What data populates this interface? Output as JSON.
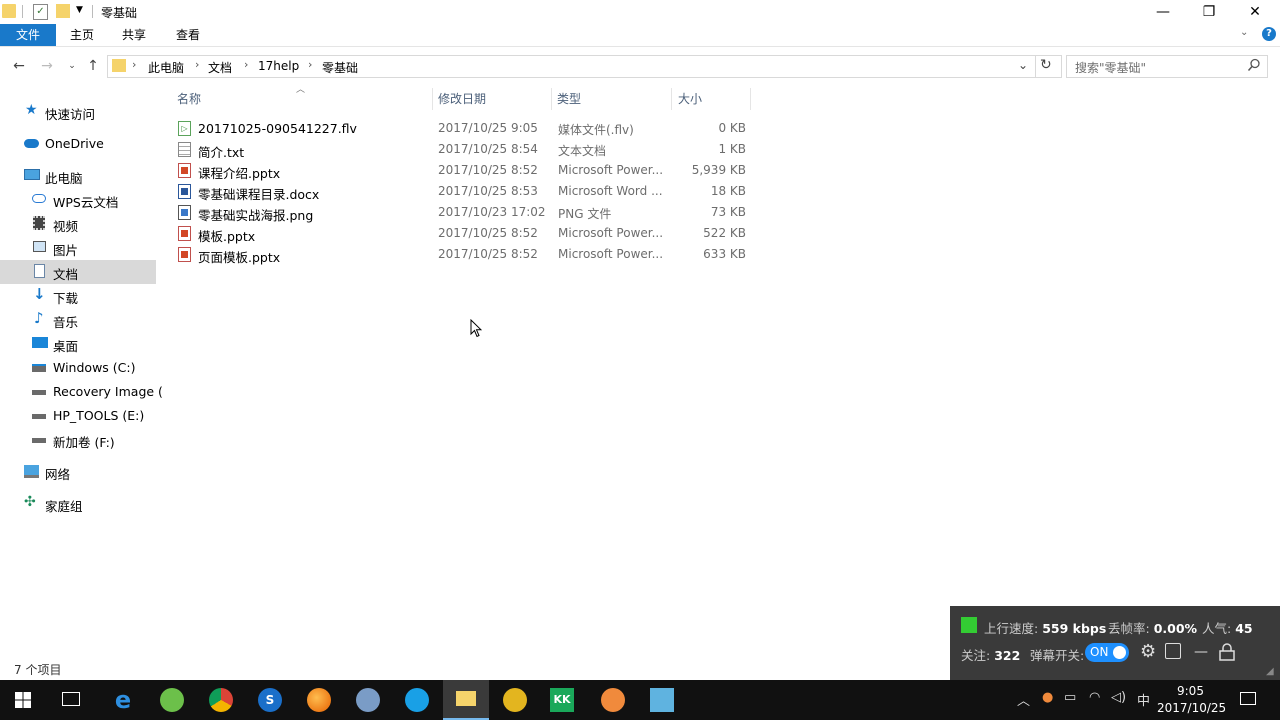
{
  "window": {
    "title": "零基础",
    "controls": {
      "minimize": "—",
      "maximize": "❐",
      "close": "✕"
    }
  },
  "ribbon": {
    "tabs": [
      "文件",
      "主页",
      "共享",
      "查看"
    ],
    "help": "?"
  },
  "address": {
    "crumbs": [
      "此电脑",
      "文档",
      "17help",
      "零基础"
    ],
    "search_placeholder": "搜索\"零基础\""
  },
  "sidebar": {
    "items": [
      {
        "label": "快速访问",
        "icon": "star-icon"
      },
      {
        "label": "OneDrive",
        "icon": "cloud-icon"
      },
      {
        "label": "此电脑",
        "icon": "computer-icon"
      },
      {
        "label": "WPS云文档",
        "icon": "cloud-outline-icon"
      },
      {
        "label": "视频",
        "icon": "video-icon"
      },
      {
        "label": "图片",
        "icon": "picture-icon"
      },
      {
        "label": "文档",
        "icon": "document-icon",
        "selected": true
      },
      {
        "label": "下载",
        "icon": "download-icon"
      },
      {
        "label": "音乐",
        "icon": "music-icon"
      },
      {
        "label": "桌面",
        "icon": "desktop-icon"
      },
      {
        "label": "Windows (C:)",
        "icon": "drive-c-icon"
      },
      {
        "label": "Recovery Image (",
        "icon": "drive-icon"
      },
      {
        "label": "HP_TOOLS (E:)",
        "icon": "drive-icon"
      },
      {
        "label": "新加卷 (F:)",
        "icon": "drive-icon"
      },
      {
        "label": "网络",
        "icon": "network-icon"
      },
      {
        "label": "家庭组",
        "icon": "homegroup-icon"
      }
    ]
  },
  "columns": {
    "name": "名称",
    "date": "修改日期",
    "type": "类型",
    "size": "大小"
  },
  "files": [
    {
      "name": "20171025-090541227.flv",
      "date": "2017/10/25 9:05",
      "type": "媒体文件(.flv)",
      "size": "0 KB",
      "icon": "video-file-icon"
    },
    {
      "name": "简介.txt",
      "date": "2017/10/25 8:54",
      "type": "文本文档",
      "size": "1 KB",
      "icon": "text-file-icon"
    },
    {
      "name": "课程介绍.pptx",
      "date": "2017/10/25 8:52",
      "type": "Microsoft Power...",
      "size": "5,939 KB",
      "icon": "pptx-file-icon"
    },
    {
      "name": "零基础课程目录.docx",
      "date": "2017/10/25 8:53",
      "type": "Microsoft Word ...",
      "size": "18 KB",
      "icon": "docx-file-icon"
    },
    {
      "name": "零基础实战海报.png",
      "date": "2017/10/23 17:02",
      "type": "PNG 文件",
      "size": "73 KB",
      "icon": "image-file-icon"
    },
    {
      "name": "模板.pptx",
      "date": "2017/10/25 8:52",
      "type": "Microsoft Power...",
      "size": "522 KB",
      "icon": "pptx-file-icon"
    },
    {
      "name": "页面模板.pptx",
      "date": "2017/10/25 8:52",
      "type": "Microsoft Power...",
      "size": "633 KB",
      "icon": "pptx-file-icon"
    }
  ],
  "status": {
    "item_count": "7 个项目"
  },
  "live_panel": {
    "upload_label": "上行速度:",
    "upload_value": "559 kbps",
    "loss_label": "丢帧率:",
    "loss_value": "0.00%",
    "popularity_label": "人气:",
    "popularity_value": "45",
    "follow_label": "关注:",
    "follow_value": "322",
    "danmaku_label": "弹幕开关:",
    "danmaku_state": "ON"
  },
  "taskbar": {
    "time": "9:05",
    "date": "2017/10/25",
    "ime": "中"
  },
  "colors": {
    "accent": "#1979ca",
    "selected_bg": "#d9d9d9",
    "panel_bg": "#3a3a3a",
    "toggle_on": "#1e90ff",
    "live_green": "#33cc33"
  }
}
